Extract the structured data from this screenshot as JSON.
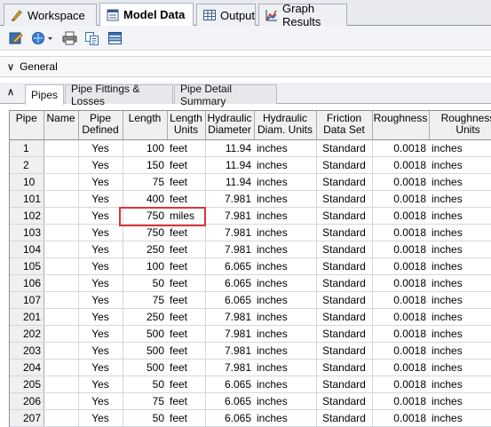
{
  "top_tabs": [
    {
      "label": "Workspace",
      "icon": "workspace-icon"
    },
    {
      "label": "Model Data",
      "icon": "model-data-icon",
      "active": true
    },
    {
      "label": "Output",
      "icon": "output-icon"
    },
    {
      "label": "Graph Results",
      "icon": "graph-results-icon"
    }
  ],
  "toolbar": {
    "icons": [
      "edit-icon",
      "globe-dropdown-icon",
      "print-icon",
      "copy-icon",
      "list-icon"
    ]
  },
  "general": {
    "label": "General"
  },
  "sub_tabs": [
    {
      "label": "Pipes",
      "active": true
    },
    {
      "label": "Pipe Fittings & Losses"
    },
    {
      "label": "Pipe Detail Summary"
    }
  ],
  "table": {
    "headers": {
      "pipe": "Pipe",
      "name": "Name",
      "pipe_defined": "Pipe\nDefined",
      "length": "Length",
      "length_units": "Length\nUnits",
      "hydraulic_diameter": "Hydraulic\nDiameter",
      "hydraulic_diam_units": "Hydraulic\nDiam. Units",
      "friction_data_set": "Friction\nData Set",
      "roughness": "Roughness",
      "roughness_units": "Roughness\nUnits"
    },
    "rows": [
      {
        "pipe": "1",
        "name": "",
        "defined": "Yes",
        "length": "100",
        "length_units": "feet",
        "diameter": "11.94",
        "diam_units": "inches",
        "friction": "Standard",
        "roughness": "0.0018",
        "rough_units": "inches"
      },
      {
        "pipe": "2",
        "name": "",
        "defined": "Yes",
        "length": "150",
        "length_units": "feet",
        "diameter": "11.94",
        "diam_units": "inches",
        "friction": "Standard",
        "roughness": "0.0018",
        "rough_units": "inches"
      },
      {
        "pipe": "10",
        "name": "",
        "defined": "Yes",
        "length": "75",
        "length_units": "feet",
        "diameter": "11.94",
        "diam_units": "inches",
        "friction": "Standard",
        "roughness": "0.0018",
        "rough_units": "inches"
      },
      {
        "pipe": "101",
        "name": "",
        "defined": "Yes",
        "length": "400",
        "length_units": "feet",
        "diameter": "7.981",
        "diam_units": "inches",
        "friction": "Standard",
        "roughness": "0.0018",
        "rough_units": "inches"
      },
      {
        "pipe": "102",
        "name": "",
        "defined": "Yes",
        "length": "750",
        "length_units": "miles",
        "diameter": "7.981",
        "diam_units": "inches",
        "friction": "Standard",
        "roughness": "0.0018",
        "rough_units": "inches"
      },
      {
        "pipe": "103",
        "name": "",
        "defined": "Yes",
        "length": "750",
        "length_units": "feet",
        "diameter": "7.981",
        "diam_units": "inches",
        "friction": "Standard",
        "roughness": "0.0018",
        "rough_units": "inches"
      },
      {
        "pipe": "104",
        "name": "",
        "defined": "Yes",
        "length": "250",
        "length_units": "feet",
        "diameter": "7.981",
        "diam_units": "inches",
        "friction": "Standard",
        "roughness": "0.0018",
        "rough_units": "inches"
      },
      {
        "pipe": "105",
        "name": "",
        "defined": "Yes",
        "length": "100",
        "length_units": "feet",
        "diameter": "6.065",
        "diam_units": "inches",
        "friction": "Standard",
        "roughness": "0.0018",
        "rough_units": "inches"
      },
      {
        "pipe": "106",
        "name": "",
        "defined": "Yes",
        "length": "50",
        "length_units": "feet",
        "diameter": "6.065",
        "diam_units": "inches",
        "friction": "Standard",
        "roughness": "0.0018",
        "rough_units": "inches"
      },
      {
        "pipe": "107",
        "name": "",
        "defined": "Yes",
        "length": "75",
        "length_units": "feet",
        "diameter": "6.065",
        "diam_units": "inches",
        "friction": "Standard",
        "roughness": "0.0018",
        "rough_units": "inches"
      },
      {
        "pipe": "201",
        "name": "",
        "defined": "Yes",
        "length": "250",
        "length_units": "feet",
        "diameter": "7.981",
        "diam_units": "inches",
        "friction": "Standard",
        "roughness": "0.0018",
        "rough_units": "inches"
      },
      {
        "pipe": "202",
        "name": "",
        "defined": "Yes",
        "length": "500",
        "length_units": "feet",
        "diameter": "7.981",
        "diam_units": "inches",
        "friction": "Standard",
        "roughness": "0.0018",
        "rough_units": "inches"
      },
      {
        "pipe": "203",
        "name": "",
        "defined": "Yes",
        "length": "500",
        "length_units": "feet",
        "diameter": "7.981",
        "diam_units": "inches",
        "friction": "Standard",
        "roughness": "0.0018",
        "rough_units": "inches"
      },
      {
        "pipe": "204",
        "name": "",
        "defined": "Yes",
        "length": "500",
        "length_units": "feet",
        "diameter": "7.981",
        "diam_units": "inches",
        "friction": "Standard",
        "roughness": "0.0018",
        "rough_units": "inches"
      },
      {
        "pipe": "205",
        "name": "",
        "defined": "Yes",
        "length": "50",
        "length_units": "feet",
        "diameter": "6.065",
        "diam_units": "inches",
        "friction": "Standard",
        "roughness": "0.0018",
        "rough_units": "inches"
      },
      {
        "pipe": "206",
        "name": "",
        "defined": "Yes",
        "length": "75",
        "length_units": "feet",
        "diameter": "6.065",
        "diam_units": "inches",
        "friction": "Standard",
        "roughness": "0.0018",
        "rough_units": "inches"
      },
      {
        "pipe": "207",
        "name": "",
        "defined": "Yes",
        "length": "50",
        "length_units": "feet",
        "diameter": "6.065",
        "diam_units": "inches",
        "friction": "Standard",
        "roughness": "0.0018",
        "rough_units": "inches"
      }
    ]
  },
  "colors": {
    "highlight": "#d9373b",
    "header_bg": "#f0f0f0"
  }
}
